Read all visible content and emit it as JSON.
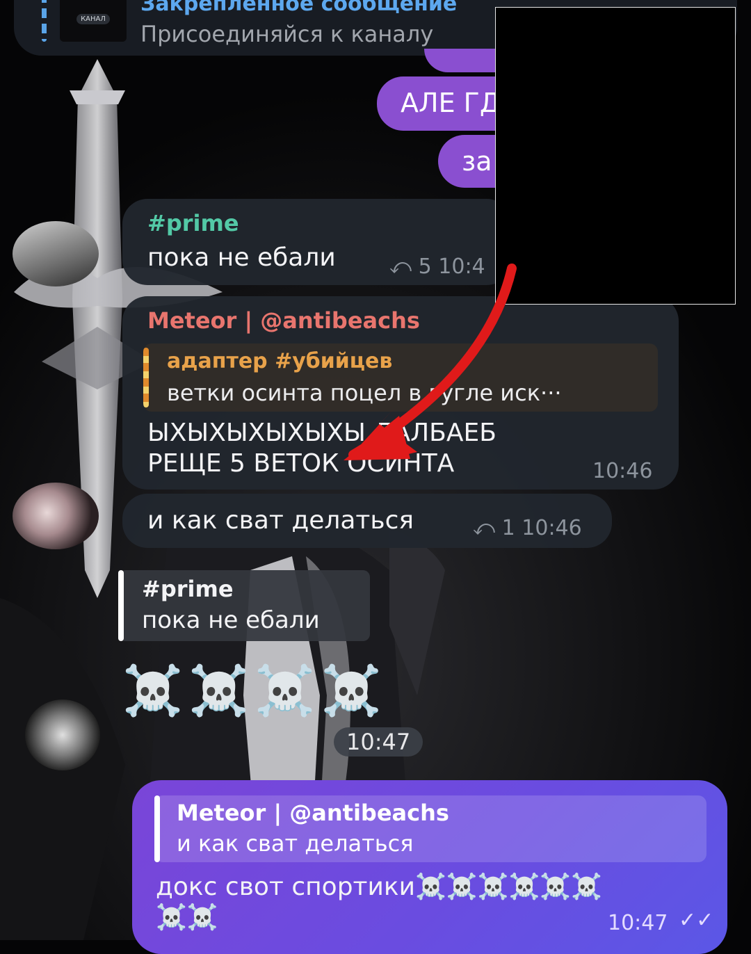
{
  "pinned": {
    "title": "Закрепленное сообщение",
    "text": "Присоединяйся к каналу",
    "thumb_label": "КАНАЛ"
  },
  "outgoing_top": [
    {
      "text": "АЛЕ ГД"
    },
    {
      "text": "за"
    }
  ],
  "messages": [
    {
      "sender": "#prime",
      "text": "пока не ебали",
      "replies": "5",
      "time": "10:4"
    },
    {
      "sender": "Meteor | @antibeachs",
      "quote_author": "адаптер #убийцев",
      "quote_text": "ветки осинта поцел в гугле иск···",
      "line1": "ЫХЫХЫХЫХЫХЫ ДАЛБАЕБ",
      "line2": "РЕЩЕ 5 ВЕТОК ОСИНТА",
      "time": "10:46"
    },
    {
      "text": "и как сват делаться",
      "replies": "1",
      "time": "10:46"
    },
    {
      "sender": "#prime",
      "text": "пока не ебали"
    },
    {
      "skulls": "☠️☠️☠️☠️",
      "time": "10:47"
    }
  ],
  "outgoing_final": {
    "quote_author": "Meteor | @antibeachs",
    "quote_text": "и как сват делаться",
    "line1": "докс свот спортики☠️☠️☠️☠️☠️☠️",
    "line2": "☠️☠️",
    "time": "10:47"
  },
  "colors": {
    "accent_blue": "#5da8ef",
    "sender_green": "#53c9a6",
    "sender_red": "#e8756e",
    "quote_orange": "#e08a2c",
    "outgoing_purple": "#8a4fd0",
    "arrow_red": "#e01a1a"
  },
  "icons": [
    "reply-arrow-icon",
    "double-check-icon",
    "skull-emoji-icon"
  ]
}
